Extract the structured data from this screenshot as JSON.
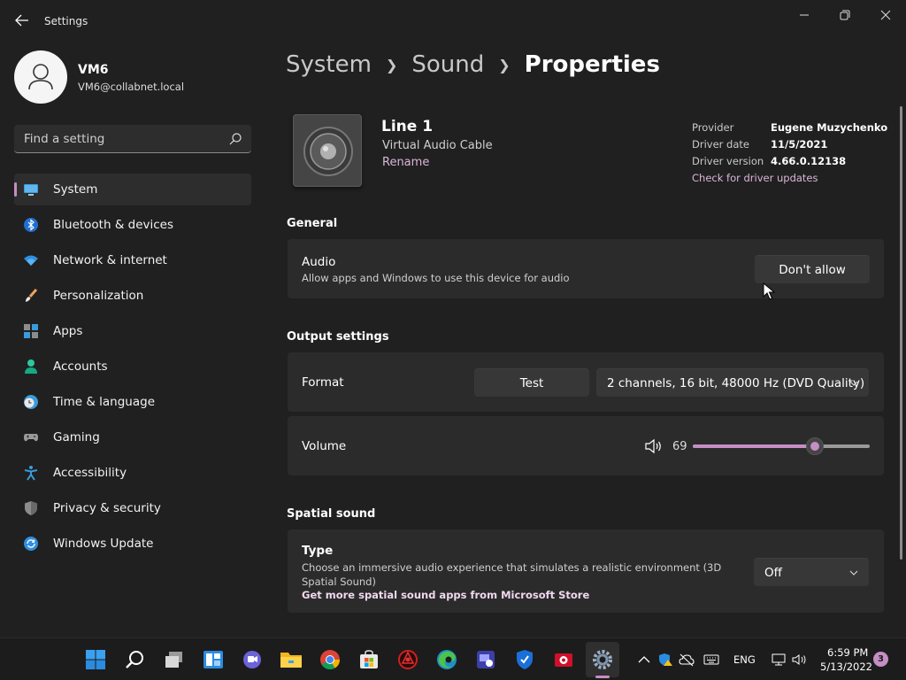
{
  "window": {
    "title": "Settings",
    "controls": [
      "minimize",
      "maximize",
      "close"
    ]
  },
  "profile": {
    "name": "VM6",
    "email": "VM6@collabnet.local"
  },
  "search": {
    "placeholder": "Find a setting"
  },
  "sidebar": {
    "items": [
      {
        "label": "System",
        "icon": "system-icon",
        "active": true
      },
      {
        "label": "Bluetooth & devices",
        "icon": "bluetooth-icon"
      },
      {
        "label": "Network & internet",
        "icon": "wifi-icon"
      },
      {
        "label": "Personalization",
        "icon": "brush-icon"
      },
      {
        "label": "Apps",
        "icon": "apps-icon"
      },
      {
        "label": "Accounts",
        "icon": "person-icon"
      },
      {
        "label": "Time & language",
        "icon": "clock-globe-icon"
      },
      {
        "label": "Gaming",
        "icon": "gamepad-icon"
      },
      {
        "label": "Accessibility",
        "icon": "accessibility-icon"
      },
      {
        "label": "Privacy & security",
        "icon": "shield-icon"
      },
      {
        "label": "Windows Update",
        "icon": "update-icon"
      }
    ]
  },
  "breadcrumb": {
    "items": [
      "System",
      "Sound",
      "Properties"
    ]
  },
  "device": {
    "name": "Line 1",
    "subtitle": "Virtual Audio Cable",
    "rename": "Rename",
    "icon": "speaker-icon"
  },
  "driver": {
    "rows": [
      {
        "key": "Provider",
        "value": "Eugene Muzychenko"
      },
      {
        "key": "Driver date",
        "value": "11/5/2021"
      },
      {
        "key": "Driver version",
        "value": "4.66.0.12138"
      }
    ],
    "link": "Check for driver updates"
  },
  "general": {
    "heading": "General",
    "audio": {
      "title": "Audio",
      "description": "Allow apps and Windows to use this device for audio",
      "button": "Don't allow"
    }
  },
  "output": {
    "heading": "Output settings",
    "format": {
      "title": "Format",
      "test_button": "Test",
      "selected": "2 channels, 16 bit, 48000 Hz (DVD Quality)"
    },
    "volume": {
      "title": "Volume",
      "value": "69",
      "level": 0.69
    }
  },
  "spatial": {
    "heading": "Spatial sound",
    "type": {
      "title": "Type",
      "description": "Choose an immersive audio experience that simulates a realistic environment (3D Spatial Sound)",
      "link": "Get more spatial sound apps from Microsoft Store",
      "selected": "Off"
    }
  },
  "taskbar": {
    "apps": [
      "start-icon",
      "search-icon",
      "task-view-icon",
      "widgets-icon",
      "chat-icon",
      "file-explorer-icon",
      "chrome-icon",
      "store-icon",
      "red-app-icon",
      "edge-icon",
      "remote-app-icon",
      "defender-icon",
      "recorder-icon",
      "settings-icon"
    ],
    "language": "ENG",
    "time": "6:59 PM",
    "date": "5/13/2022",
    "notifications": "3"
  },
  "colors": {
    "accent": "#c58ec4",
    "background": "#202020",
    "card": "#2b2b2b"
  }
}
